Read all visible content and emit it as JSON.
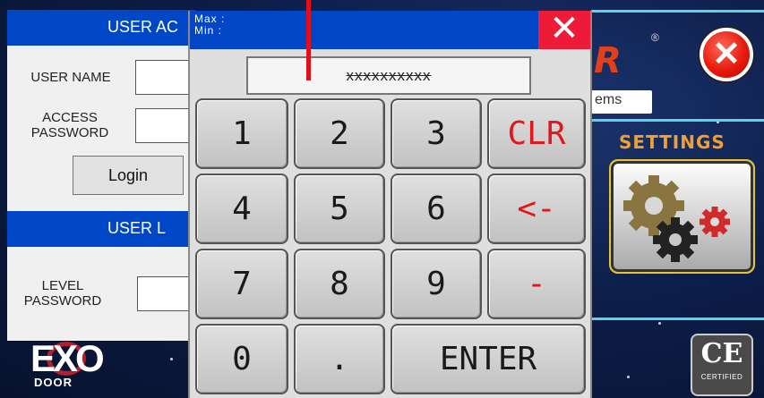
{
  "background_app": {
    "brand_partial": "R",
    "registered_mark": "®",
    "close_symbol": "✕",
    "system_tag": "ems",
    "settings_label": "SETTINGS",
    "ce_mark": "CE",
    "ce_caption": "CERTIFIED",
    "logo_text": "EXO",
    "logo_subtext": "DOOR"
  },
  "login_panel": {
    "section1_title": "USER AC",
    "user_name_label": "USER NAME",
    "access_password_label": "ACCESS PASSWORD",
    "login_button": "Login",
    "section2_title": "USER L",
    "level_password_label": "LEVEL PASSWORD",
    "user_name_value": "",
    "access_password_value": "",
    "level_password_value": ""
  },
  "keypad": {
    "max_label": "Max :",
    "min_label": "Min :",
    "close_symbol": "✕",
    "display_value": "xxxxxxxxxx",
    "keys": {
      "k1": "1",
      "k2": "2",
      "k3": "3",
      "clr": "CLR",
      "k4": "4",
      "k5": "5",
      "k6": "6",
      "back": "<-",
      "k7": "7",
      "k8": "8",
      "k9": "9",
      "minus": "-",
      "k0": "0",
      "dot": ".",
      "enter": "ENTER"
    }
  },
  "colors": {
    "header_blue": "#0047c8",
    "keypad_close_red": "#ee1a3a",
    "action_key_red": "#e0181a",
    "settings_orange": "#f0a030",
    "accent_cyan": "#5fd2e8"
  }
}
